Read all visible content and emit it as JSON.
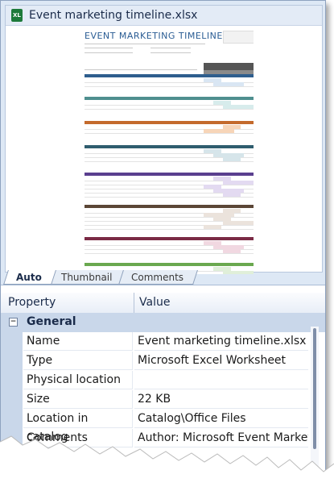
{
  "preview": {
    "file_name": "Event marketing timeline.xlsx",
    "file_icon": "excel-file-icon",
    "sheet_title": "EVENT MARKETING TIMELINE TE",
    "tabs": [
      {
        "label": "Auto",
        "active": true
      },
      {
        "label": "Thumbnail",
        "active": false
      },
      {
        "label": "Comments",
        "active": false
      }
    ]
  },
  "grid": {
    "columns": {
      "property": "Property",
      "value": "Value"
    },
    "group": {
      "label": "General",
      "expander": "⊟"
    },
    "rows": [
      {
        "name": "Name",
        "value": "Event marketing timeline.xlsx"
      },
      {
        "name": "Type",
        "value": "Microsoft Excel Worksheet"
      },
      {
        "name": "Physical location",
        "value": ""
      },
      {
        "name": "Size",
        "value": "22 KB"
      },
      {
        "name": "Location in catalog",
        "value": "Catalog\\Office Files"
      },
      {
        "name": "Comments",
        "value": "Author: Microsoft Event Marketi..."
      }
    ]
  },
  "colors": {
    "group_bg": "#c9d7ea",
    "header_bg": "#e3ebf6",
    "accent": "#2b5d94"
  }
}
